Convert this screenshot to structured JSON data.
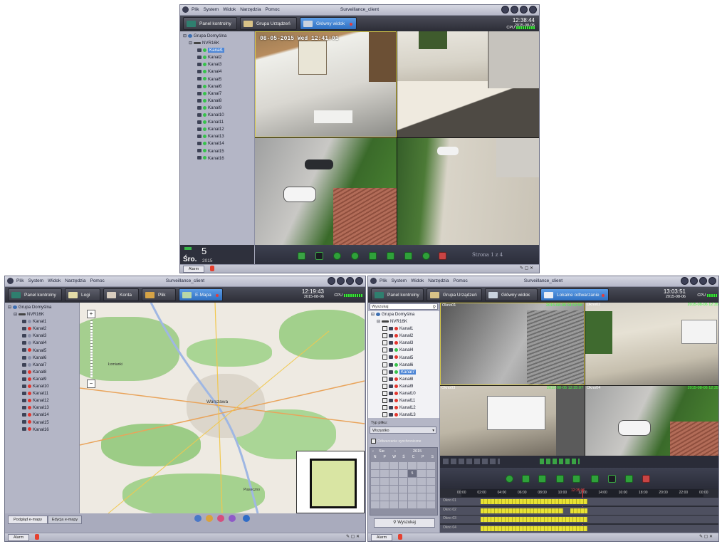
{
  "top_window": {
    "title": "Surveillance_client",
    "menu": [
      "Plik",
      "System",
      "Widok",
      "Narzędzia",
      "Pomoc"
    ],
    "tabs": [
      "Panel kontrolny",
      "Grupa Urządzeń",
      "Główny widok"
    ],
    "active_tab": 2,
    "time": "12:38:44",
    "date": "2015-08-05",
    "cpu_label": "CPU",
    "tree_root": "Grupa Domyślna",
    "tree_device": "NVR16K",
    "channels": [
      "Kanał1",
      "Kanał2",
      "Kanał3",
      "Kanał4",
      "Kanał5",
      "Kanał6",
      "Kanał7",
      "Kanał8",
      "Kanał9",
      "Kanał10",
      "Kanał11",
      "Kanał12",
      "Kanał13",
      "Kanał14",
      "Kanał15",
      "Kanał16"
    ],
    "selected_channel": 0,
    "osd_text": "08-05-2015 Wed 12:41:01",
    "day_number": "5",
    "day_name": "Śro.",
    "year": "2015",
    "page_label": "Strona 1 z 4",
    "alarm_label": "Alarm"
  },
  "emap_window": {
    "title": "Surveillance_client",
    "menu": [
      "Plik",
      "System",
      "Widok",
      "Narzędzia",
      "Pomoc"
    ],
    "tabs": [
      "Panel kontrolny",
      "Logi",
      "Konta",
      "Plik",
      "E-Mapa"
    ],
    "active_tab": 4,
    "time": "12:19:43",
    "date": "2015-08-06",
    "cpu_label": "CPU",
    "tree_root": "Grupa Domyślna",
    "tree_device": "NVR16K",
    "channels": [
      "Kanał1",
      "Kanał2",
      "Kanał3",
      "Kanał4",
      "Kanał5",
      "Kanał6",
      "Kanał7",
      "Kanał8",
      "Kanał9",
      "Kanał10",
      "Kanał11",
      "Kanał12",
      "Kanał13",
      "Kanał14",
      "Kanał15",
      "Kanał16"
    ],
    "channel_active": [
      true,
      false,
      true,
      true,
      false,
      true,
      true,
      false,
      false,
      false,
      false,
      false,
      false,
      false,
      false,
      false
    ],
    "map_labels": [
      "Warszawa",
      "Łomianki",
      "Piaseczno"
    ],
    "view_button": "Podgląd e-mapy",
    "edit_button": "Edycja e-mapy",
    "alarm_label": "Alarm"
  },
  "playback_window": {
    "title": "Surveillance_client",
    "menu": [
      "Plik",
      "System",
      "Widok",
      "Narzędzia",
      "Pomoc"
    ],
    "tabs": [
      "Panel kontrolny",
      "Grupa Urządzeń",
      "Główny widok",
      "Lokalne odtwarzanie"
    ],
    "active_tab": 3,
    "time": "13:03:51",
    "date": "2015-08-06",
    "cpu_label": "CPU",
    "search_placeholder": "Wyszukaj",
    "tree_root": "Grupa Domyślna",
    "tree_device": "NVR16K",
    "channels": [
      "Kanał1",
      "Kanał2",
      "Kanał3",
      "Kanał4",
      "Kanał5",
      "Kanał6",
      "Kanał7",
      "Kanał8",
      "Kanał9",
      "Kanał10",
      "Kanał11",
      "Kanał12",
      "Kanał13"
    ],
    "file_type_label": "Typ pliku:",
    "file_type_value": "Wszystko",
    "sync_label": "Odtwarzanie synchroniczne",
    "calendar_month": "Sie",
    "calendar_year": "2015",
    "calendar_days": [
      "N",
      "P",
      "W",
      "Ś",
      "C",
      "P",
      "S"
    ],
    "calendar_selected": "5",
    "search_button": "Wyszukaj",
    "windows": [
      {
        "label": "Okno01",
        "ts": "2015-08-05 04:52:58"
      },
      {
        "label": "Okno02",
        "ts": "2015-08-06 12:35"
      },
      {
        "label": "Okno03",
        "ts": "2015-08-05 12:35:07"
      },
      {
        "label": "Okno04",
        "ts": "2015-08-06 12:35"
      }
    ],
    "timeline_hours": [
      "00:00",
      "02:00",
      "04:00",
      "06:00",
      "08:00",
      "10:00",
      "12:00",
      "14:00",
      "16:00",
      "18:00",
      "20:00",
      "22:00",
      "00:00"
    ],
    "timeline_cursor": "12:35:06",
    "timeline_rows": [
      "Okno 01",
      "Okno 02",
      "Okno 03",
      "Okno 04"
    ],
    "alarm_label": "Alarm"
  }
}
